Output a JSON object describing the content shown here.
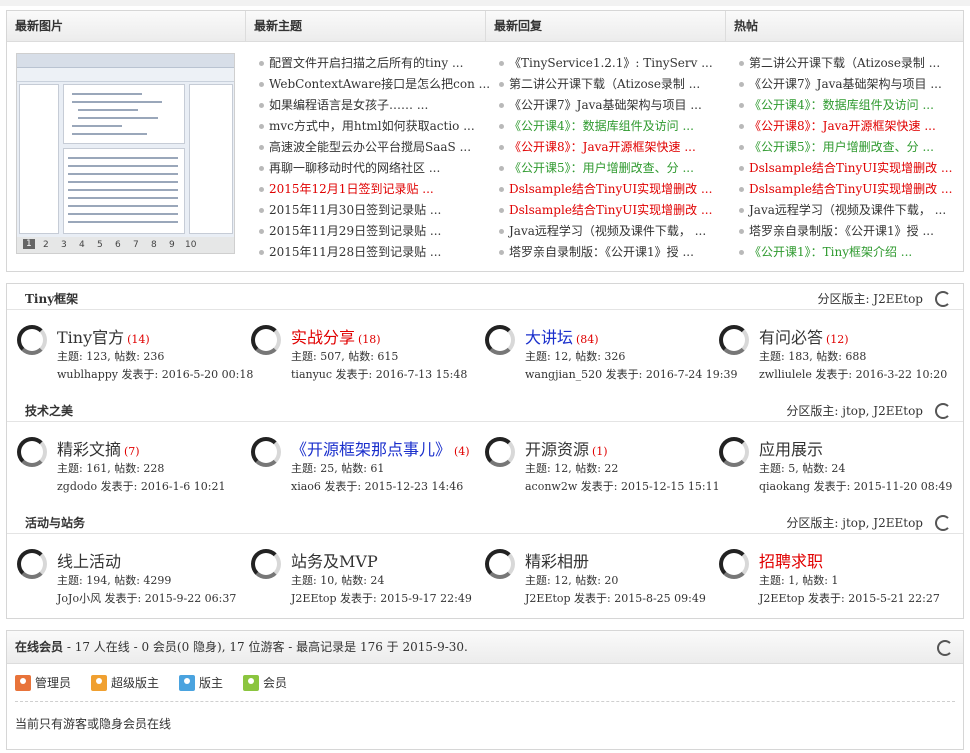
{
  "portal": {
    "headers": [
      "最新图片",
      "最新主题",
      "最新回复",
      "热帖"
    ],
    "image_pager": [
      "1",
      "2",
      "3",
      "4",
      "5",
      "6",
      "7",
      "8",
      "9",
      "10"
    ],
    "latest_topics": [
      {
        "text": "配置文件开启扫描之后所有的tiny ...",
        "color": "default"
      },
      {
        "text": "WebContextAware接口是怎么把con ...",
        "color": "default"
      },
      {
        "text": "如果编程语言是女孩子…… ...",
        "color": "default"
      },
      {
        "text": "mvc方式中，用html如何获取actio ...",
        "color": "default"
      },
      {
        "text": "高速波全能型云办公平台搅局SaaS ...",
        "color": "default"
      },
      {
        "text": "再聊一聊移动时代的网络社区 ...",
        "color": "default"
      },
      {
        "text": "2015年12月1日签到记录贴 ...",
        "color": "red"
      },
      {
        "text": "2015年11月30日签到记录贴 ...",
        "color": "default"
      },
      {
        "text": "2015年11月29日签到记录贴 ...",
        "color": "default"
      },
      {
        "text": "2015年11月28日签到记录贴 ...",
        "color": "default"
      }
    ],
    "latest_replies": [
      {
        "text": "《TinyService1.2.1》: TinyServ ...",
        "color": "default"
      },
      {
        "text": "第二讲公开课下载（Atizose录制 ...",
        "color": "default"
      },
      {
        "text": "《公开课7》Java基础架构与项目 ...",
        "color": "default"
      },
      {
        "text": "《公开课4》：数据库组件及访问 ...",
        "color": "green"
      },
      {
        "text": "《公开课8》：Java开源框架快速 ...",
        "color": "red"
      },
      {
        "text": "《公开课5》：用户增删改查、分 ...",
        "color": "green"
      },
      {
        "text": "Dslsample结合TinyUI实现增删改 ...",
        "color": "red"
      },
      {
        "text": "Dslsample结合TinyUI实现增删改 ...",
        "color": "red"
      },
      {
        "text": "Java远程学习（视频及课件下载， ...",
        "color": "default"
      },
      {
        "text": "塔罗亲自录制版：《公开课1》授 ...",
        "color": "default"
      }
    ],
    "hot_posts": [
      {
        "text": "第二讲公开课下载（Atizose录制 ...",
        "color": "default"
      },
      {
        "text": "《公开课7》Java基础架构与项目 ...",
        "color": "default"
      },
      {
        "text": "《公开课4》：数据库组件及访问 ...",
        "color": "green"
      },
      {
        "text": "《公开课8》：Java开源框架快速 ...",
        "color": "red"
      },
      {
        "text": "《公开课5》：用户增删改查、分 ...",
        "color": "green"
      },
      {
        "text": "Dslsample结合TinyUI实现增删改 ...",
        "color": "red"
      },
      {
        "text": "Dslsample结合TinyUI实现增删改 ...",
        "color": "red"
      },
      {
        "text": "Java远程学习（视频及课件下载， ...",
        "color": "default"
      },
      {
        "text": "塔罗亲自录制版：《公开课1》授 ...",
        "color": "default"
      },
      {
        "text": "《公开课1》：Tiny框架介绍 ...",
        "color": "green"
      }
    ]
  },
  "categories": [
    {
      "title": "Tiny框架",
      "moderators": "分区版主: J2EEtop",
      "boards": [
        {
          "name": "Tiny官方",
          "count": "(14)",
          "color": "default",
          "stats": "主题: 123, 帖数: 236",
          "last": "wublhappy 发表于: 2016-5-20 00:18"
        },
        {
          "name": "实战分享",
          "count": "(18)",
          "color": "red",
          "stats": "主题: 507, 帖数: 615",
          "last": "tianyuc 发表于: 2016-7-13 15:48"
        },
        {
          "name": "大讲坛",
          "count": "(84)",
          "color": "blue",
          "stats": "主题: 12, 帖数: 326",
          "last": "wangjian_520 发表于: 2016-7-24 19:39"
        },
        {
          "name": "有问必答",
          "count": "(12)",
          "color": "default",
          "stats": "主题: 183, 帖数: 688",
          "last": "zwlliulele 发表于: 2016-3-22 10:20"
        }
      ]
    },
    {
      "title": "技术之美",
      "moderators": "分区版主: jtop, J2EEtop",
      "boards": [
        {
          "name": "精彩文摘",
          "count": "(7)",
          "color": "default",
          "stats": "主题: 161, 帖数: 228",
          "last": "zgdodo 发表于: 2016-1-6 10:21"
        },
        {
          "name": "《开源框架那点事儿》",
          "count": "(4)",
          "color": "blue",
          "stats": "主题: 25, 帖数: 61",
          "last": "xiao6 发表于: 2015-12-23 14:46"
        },
        {
          "name": "开源资源",
          "count": "(1)",
          "color": "default",
          "stats": "主题: 12, 帖数: 22",
          "last": "aconw2w 发表于: 2015-12-15 15:11"
        },
        {
          "name": "应用展示",
          "count": "",
          "color": "default",
          "stats": "主题: 5, 帖数: 24",
          "last": "qiaokang 发表于: 2015-11-20 08:49"
        }
      ]
    },
    {
      "title": "活动与站务",
      "moderators": "分区版主: jtop, J2EEtop",
      "boards": [
        {
          "name": "线上活动",
          "count": "",
          "color": "default",
          "stats": "主题: 194, 帖数: 4299",
          "last": "JoJo小风 发表于: 2015-9-22 06:37"
        },
        {
          "name": "站务及MVP",
          "count": "",
          "color": "default",
          "stats": "主题: 10, 帖数: 24",
          "last": "J2EEtop 发表于: 2015-9-17 22:49"
        },
        {
          "name": "精彩相册",
          "count": "",
          "color": "default",
          "stats": "主题: 12, 帖数: 20",
          "last": "J2EEtop 发表于: 2015-8-25 09:49"
        },
        {
          "name": "招聘求职",
          "count": "",
          "color": "red",
          "stats": "主题: 1, 帖数: 1",
          "last": "J2EEtop 发表于: 2015-5-21 22:27"
        }
      ]
    }
  ],
  "online": {
    "title": "在线会员",
    "summary": " - 17 人在线 - 0 会员(0 隐身), 17 位游客 - 最高记录是 176 于 2015-9-30.",
    "roles": [
      {
        "label": "管理员",
        "color": "#e8733a"
      },
      {
        "label": "超级版主",
        "color": "#f0a030"
      },
      {
        "label": "版主",
        "color": "#4aa3df"
      },
      {
        "label": "会员",
        "color": "#8bc53f"
      }
    ],
    "note": "当前只有游客或隐身会员在线"
  },
  "colors": {
    "red": "#e00000",
    "green": "#2f9a2f",
    "blue": "#1a2fcc"
  }
}
